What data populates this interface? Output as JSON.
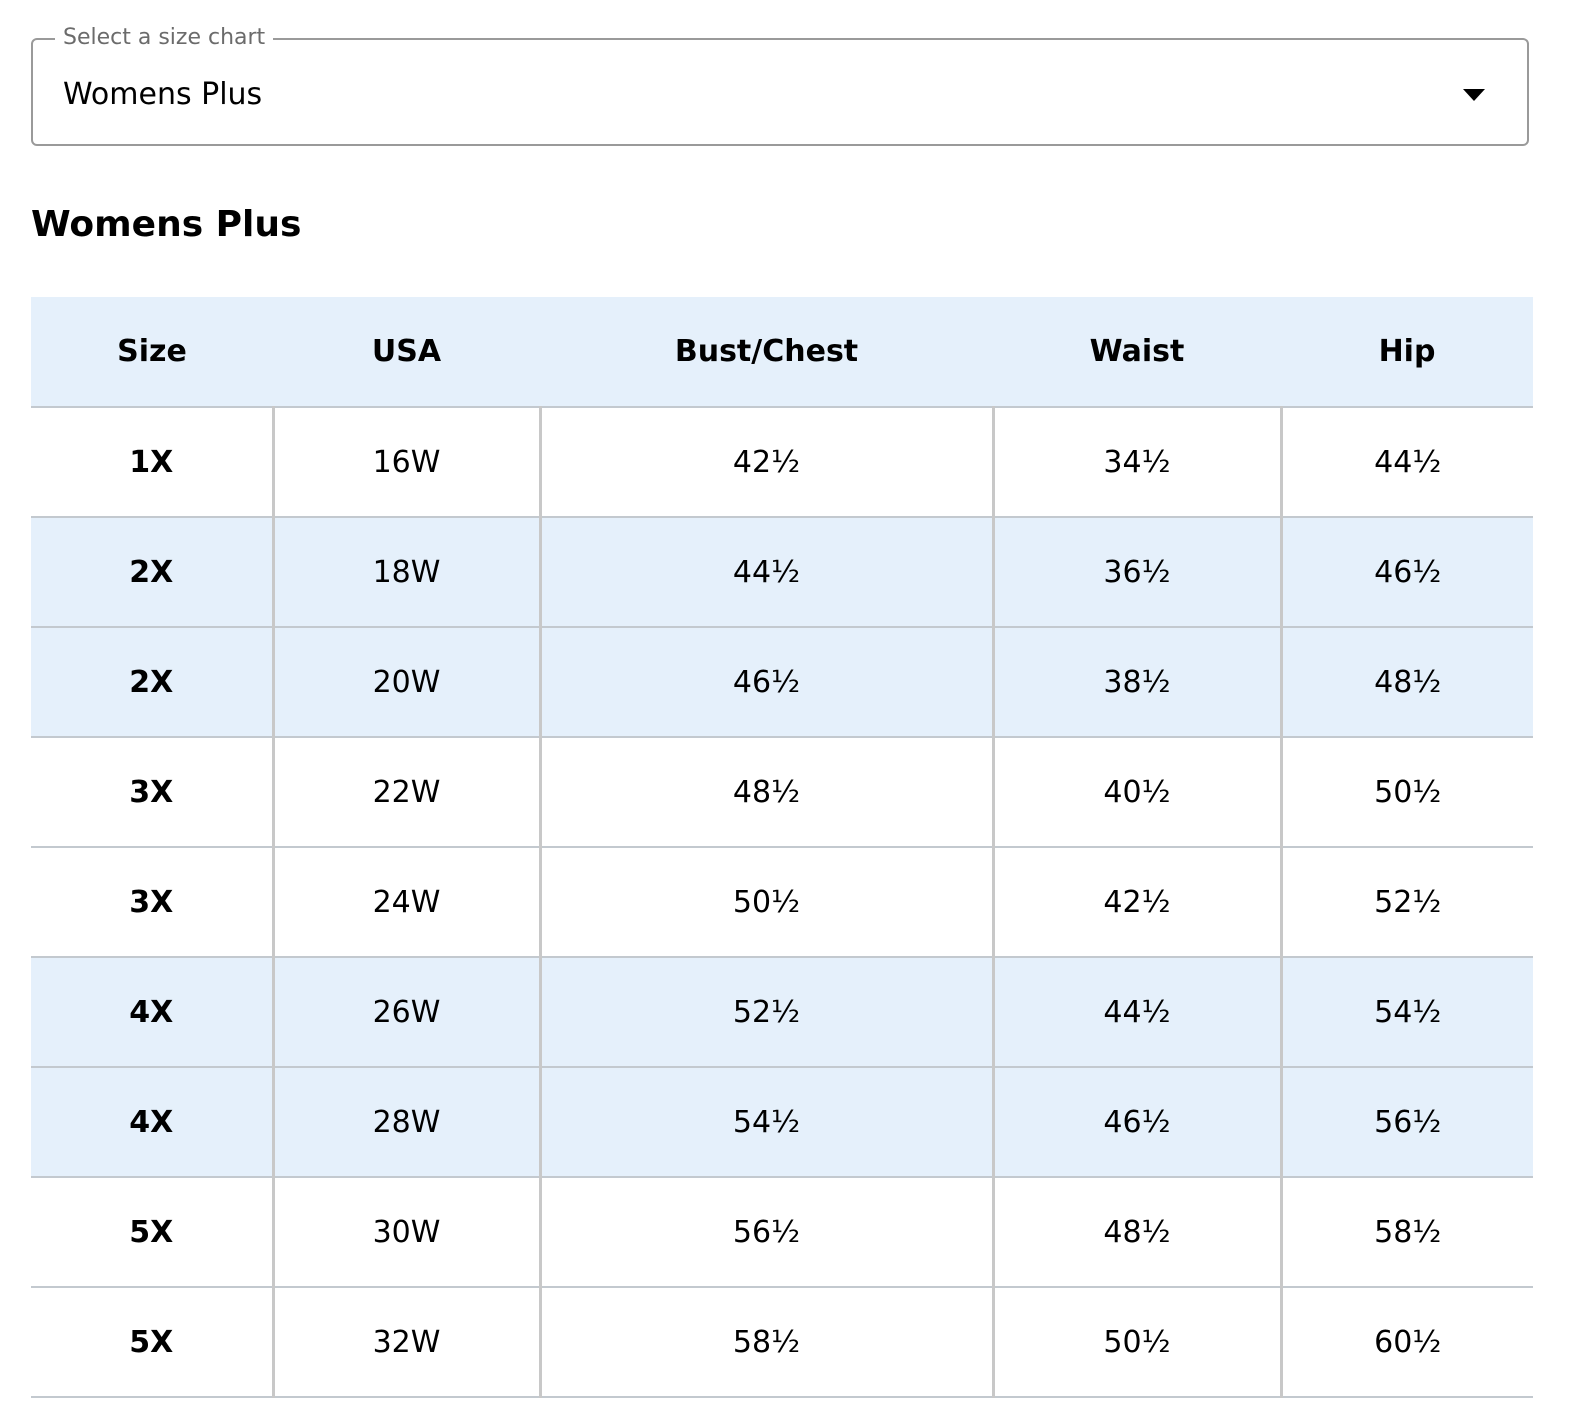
{
  "size_chart_select": {
    "legend": "Select a size chart",
    "selected": "Womens Plus"
  },
  "chart_title": "Womens Plus",
  "table": {
    "headers": [
      "Size",
      "USA",
      "Bust/Chest",
      "Waist",
      "Hip"
    ],
    "rows": [
      {
        "shaded": false,
        "cells": [
          "1X",
          "16W",
          "42½",
          "34½",
          "44½"
        ]
      },
      {
        "shaded": true,
        "cells": [
          "2X",
          "18W",
          "44½",
          "36½",
          "46½"
        ]
      },
      {
        "shaded": true,
        "cells": [
          "2X",
          "20W",
          "46½",
          "38½",
          "48½"
        ]
      },
      {
        "shaded": false,
        "cells": [
          "3X",
          "22W",
          "48½",
          "40½",
          "50½"
        ]
      },
      {
        "shaded": false,
        "cells": [
          "3X",
          "24W",
          "50½",
          "42½",
          "52½"
        ]
      },
      {
        "shaded": true,
        "cells": [
          "4X",
          "26W",
          "52½",
          "44½",
          "54½"
        ]
      },
      {
        "shaded": true,
        "cells": [
          "4X",
          "28W",
          "54½",
          "46½",
          "56½"
        ]
      },
      {
        "shaded": false,
        "cells": [
          "5X",
          "30W",
          "56½",
          "48½",
          "58½"
        ]
      },
      {
        "shaded": false,
        "cells": [
          "5X",
          "32W",
          "58½",
          "50½",
          "60½"
        ]
      }
    ]
  },
  "colors": {
    "shaded_row_background": "#e5f0fb",
    "header_background": "#e5f0fb",
    "border": "#c3c9cf"
  }
}
